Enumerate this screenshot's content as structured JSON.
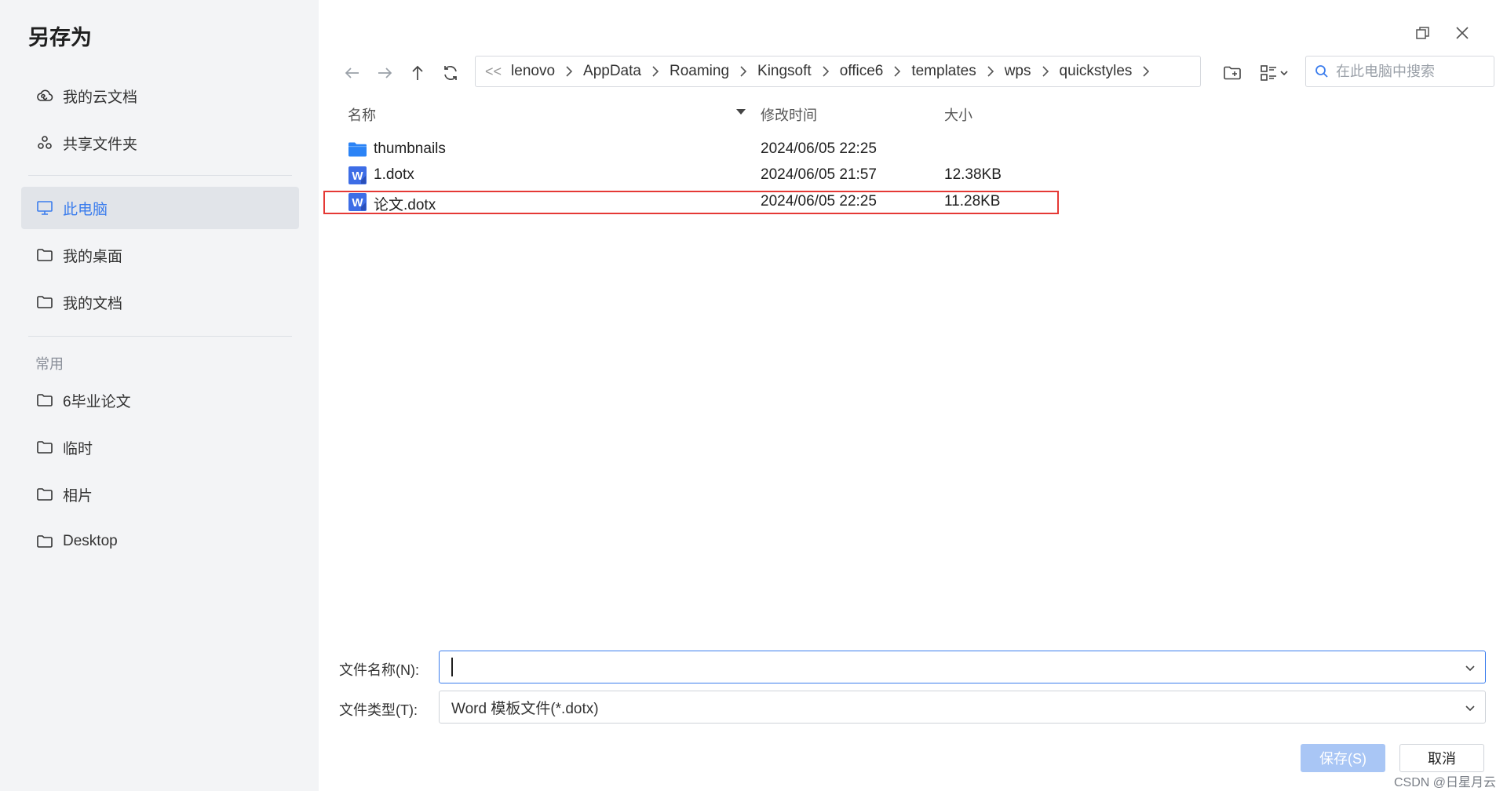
{
  "dialog": {
    "title": "另存为"
  },
  "sidebar": {
    "cloud_items": [
      {
        "label": "我的云文档",
        "icon": "cloud-icon"
      },
      {
        "label": "共享文件夹",
        "icon": "share-folder-icon"
      }
    ],
    "location_items": [
      {
        "label": "此电脑",
        "icon": "computer-icon",
        "active": true
      },
      {
        "label": "我的桌面",
        "icon": "folder-icon"
      },
      {
        "label": "我的文档",
        "icon": "folder-icon"
      }
    ],
    "common_section_label": "常用",
    "common_items": [
      {
        "label": "6毕业论文",
        "icon": "folder-icon"
      },
      {
        "label": "临时",
        "icon": "folder-icon"
      },
      {
        "label": "相片",
        "icon": "folder-icon"
      },
      {
        "label": "Desktop",
        "icon": "folder-icon"
      }
    ]
  },
  "breadcrumb": {
    "leading": "<<",
    "items": [
      "lenovo",
      "AppData",
      "Roaming",
      "Kingsoft",
      "office6",
      "templates",
      "wps",
      "quickstyles"
    ]
  },
  "search": {
    "placeholder": "在此电脑中搜索"
  },
  "columns": {
    "name": "名称",
    "modified": "修改时间",
    "size": "大小",
    "sort": "name-desc"
  },
  "files": [
    {
      "name": "thumbnails",
      "modified": "2024/06/05 22:25",
      "size": "",
      "type": "folder",
      "icon": "folder-blue-icon"
    },
    {
      "name": "1.dotx",
      "modified": "2024/06/05 21:57",
      "size": "12.38KB",
      "type": "wps-template",
      "icon": "wps-doc-icon"
    },
    {
      "name": "论文.dotx",
      "modified": "2024/06/05 22:25",
      "size": "11.28KB",
      "type": "wps-template",
      "icon": "wps-doc-icon",
      "highlighted": true
    }
  ],
  "form": {
    "filename_label": "文件名称(N):",
    "filename_value": "",
    "filetype_label": "文件类型(T):",
    "filetype_value": "Word 模板文件(*.dotx)"
  },
  "buttons": {
    "save": "保存(S)",
    "cancel": "取消"
  },
  "watermark": "CSDN @日星月云",
  "colors": {
    "accent": "#3b7ded",
    "save_disabled": "#a9c6f5",
    "highlight": "#e53935",
    "folder": "#2b83f6",
    "wps_blue": "#3d6de6"
  }
}
